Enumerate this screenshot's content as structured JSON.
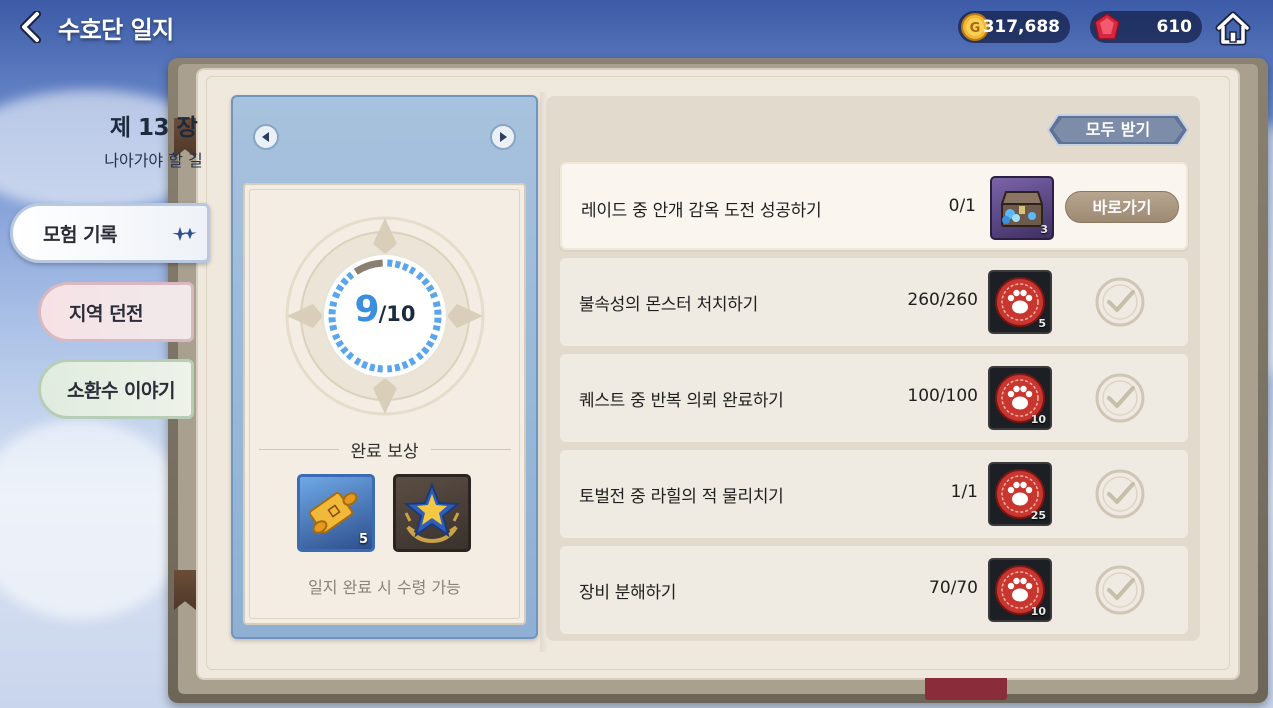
{
  "header": {
    "title": "수호단 일지",
    "gold": "317,688",
    "gems": "610"
  },
  "side_tabs": [
    {
      "label": "모험 기록",
      "selected": true
    },
    {
      "label": "지역 던전",
      "selected": false
    },
    {
      "label": "소환수 이야기",
      "selected": false
    }
  ],
  "chapter": {
    "number_label": "제 13 장",
    "subtitle": "나아가야 할 길",
    "progress_current": "9",
    "progress_total_label": "/10",
    "progress_fraction": 0.9,
    "reward_title": "완료 보상",
    "rewards": [
      {
        "icon": "scroll-icon",
        "count": "5"
      },
      {
        "icon": "star-emblem-icon",
        "count": ""
      }
    ],
    "reward_note": "일지 완료 시 수령 가능"
  },
  "quests": {
    "claim_all_label": "모두 받기",
    "go_label": "바로가기",
    "items": [
      {
        "text": "레이드 중 안개 감옥 도전 성공하기",
        "progress": "0/1",
        "reward_icon": "treasure-chest-icon",
        "reward_count": "3",
        "status": "go"
      },
      {
        "text": "불속성의 몬스터 처치하기",
        "progress": "260/260",
        "reward_icon": "paw-token-icon",
        "reward_count": "5",
        "status": "done"
      },
      {
        "text": "퀘스트 중 반복 의뢰 완료하기",
        "progress": "100/100",
        "reward_icon": "paw-token-icon",
        "reward_count": "10",
        "status": "done"
      },
      {
        "text": "토벌전 중 라힐의 적 물리치기",
        "progress": "1/1",
        "reward_icon": "paw-token-icon",
        "reward_count": "25",
        "status": "done"
      },
      {
        "text": "장비 분해하기",
        "progress": "70/70",
        "reward_icon": "paw-token-icon",
        "reward_count": "10",
        "status": "done"
      }
    ]
  },
  "colors": {
    "progress_ring": "#5aa5ec",
    "chapter_card": "#9db9d8",
    "page": "#efe8dc"
  }
}
